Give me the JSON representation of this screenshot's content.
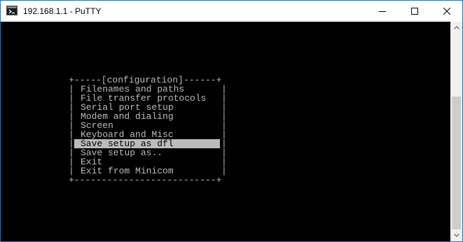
{
  "window": {
    "title": "192.168.1.1 - PuTTY",
    "colors": {
      "terminal_bg": "#000000",
      "terminal_fg": "#bbbbbb",
      "selection_bg": "#bbbbbb",
      "selection_fg": "#000000",
      "titlebar_bg": "#ffffff"
    },
    "icons": {
      "app": "putty-terminal-icon",
      "minimize": "minimize-icon",
      "maximize": "maximize-icon",
      "close": "close-icon"
    }
  },
  "menu": {
    "top_border": "+-----[configuration]------+",
    "bottom_border": "+--------------------------+",
    "side_char": "|",
    "selected_index": 6,
    "items": [
      {
        "label": "Filenames and paths"
      },
      {
        "label": "File transfer protocols"
      },
      {
        "label": "Serial port setup"
      },
      {
        "label": "Modem and dialing"
      },
      {
        "label": "Screen"
      },
      {
        "label": "Keyboard and Misc"
      },
      {
        "label": "Save setup as dfl"
      },
      {
        "label": "Save setup as.."
      },
      {
        "label": "Exit"
      },
      {
        "label": "Exit from Minicom"
      }
    ]
  }
}
